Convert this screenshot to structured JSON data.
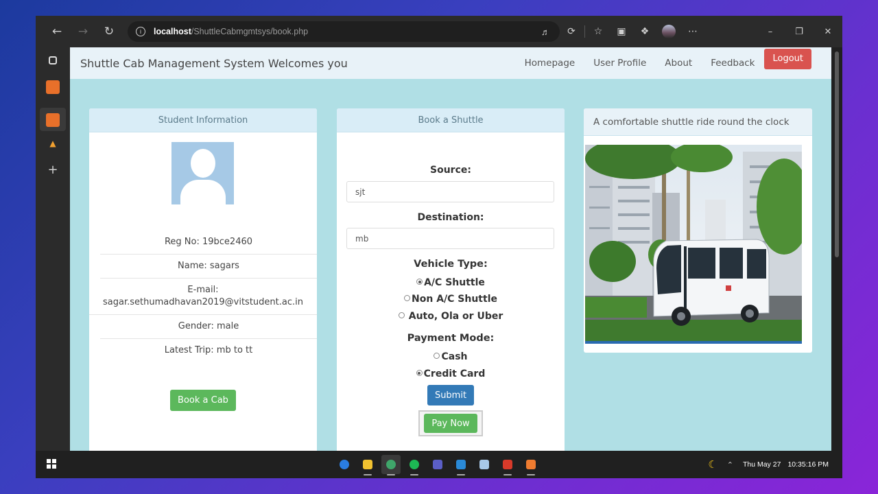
{
  "browser": {
    "url_host": "localhost",
    "url_path": "/ShuttleCabmgmtsys/book.php"
  },
  "nav": {
    "brand": "Shuttle Cab Management System Welcomes you",
    "links": [
      "Homepage",
      "User Profile",
      "About",
      "Feedback"
    ],
    "logout": "Logout"
  },
  "student": {
    "heading": "Student Information",
    "reg_no": "Reg No: 19bce2460",
    "name": "Name: sagars",
    "email_label": "E-mail:",
    "email": "sagar.sethumadhavan2019@vitstudent.ac.in",
    "gender": "Gender: male",
    "latest_trip": "Latest Trip: mb to tt",
    "book_button": "Book a Cab"
  },
  "booking": {
    "heading": "Book a Shuttle",
    "source_label": "Source:",
    "source_value": "sjt",
    "destination_label": "Destination:",
    "destination_value": "mb",
    "vehicle_label": "Vehicle Type:",
    "vehicle_options": [
      {
        "label": "A/C Shuttle",
        "selected": true
      },
      {
        "label": "Non A/C Shuttle",
        "selected": false
      },
      {
        "label": "Auto, Ola or Uber",
        "selected": false
      }
    ],
    "payment_label": "Payment Mode:",
    "payment_options": [
      {
        "label": "Cash",
        "selected": false
      },
      {
        "label": "Credit Card",
        "selected": true
      }
    ],
    "submit": "Submit",
    "pay_now": "Pay Now"
  },
  "promo": {
    "heading": "A comfortable shuttle ride round the clock"
  },
  "taskbar": {
    "date": "Thu May 27",
    "time": "10:35:16 PM"
  },
  "colors": {
    "page_bg": "#b0dfe5",
    "panel_head": "#d9edf7",
    "logout": "#d9534f",
    "green_button": "#5cb85c",
    "primary_button": "#337ab7"
  }
}
